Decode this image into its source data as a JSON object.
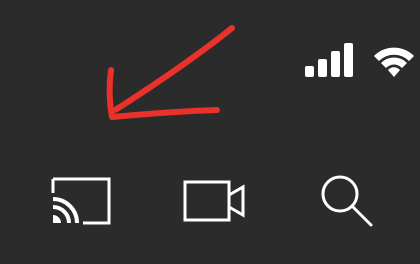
{
  "status_bar": {
    "signal_icon": "cellular-signal-icon",
    "signal_bars": 4,
    "wifi_icon": "wifi-icon"
  },
  "annotation": {
    "icon": "arrow-annotation-icon",
    "color": "#e8322a"
  },
  "toolbar": {
    "items": [
      {
        "icon": "cast-icon"
      },
      {
        "icon": "video-camera-icon"
      },
      {
        "icon": "search-icon"
      }
    ]
  },
  "colors": {
    "background": "#2b2b2b",
    "icon": "#ffffff",
    "annotation": "#e8322a"
  }
}
